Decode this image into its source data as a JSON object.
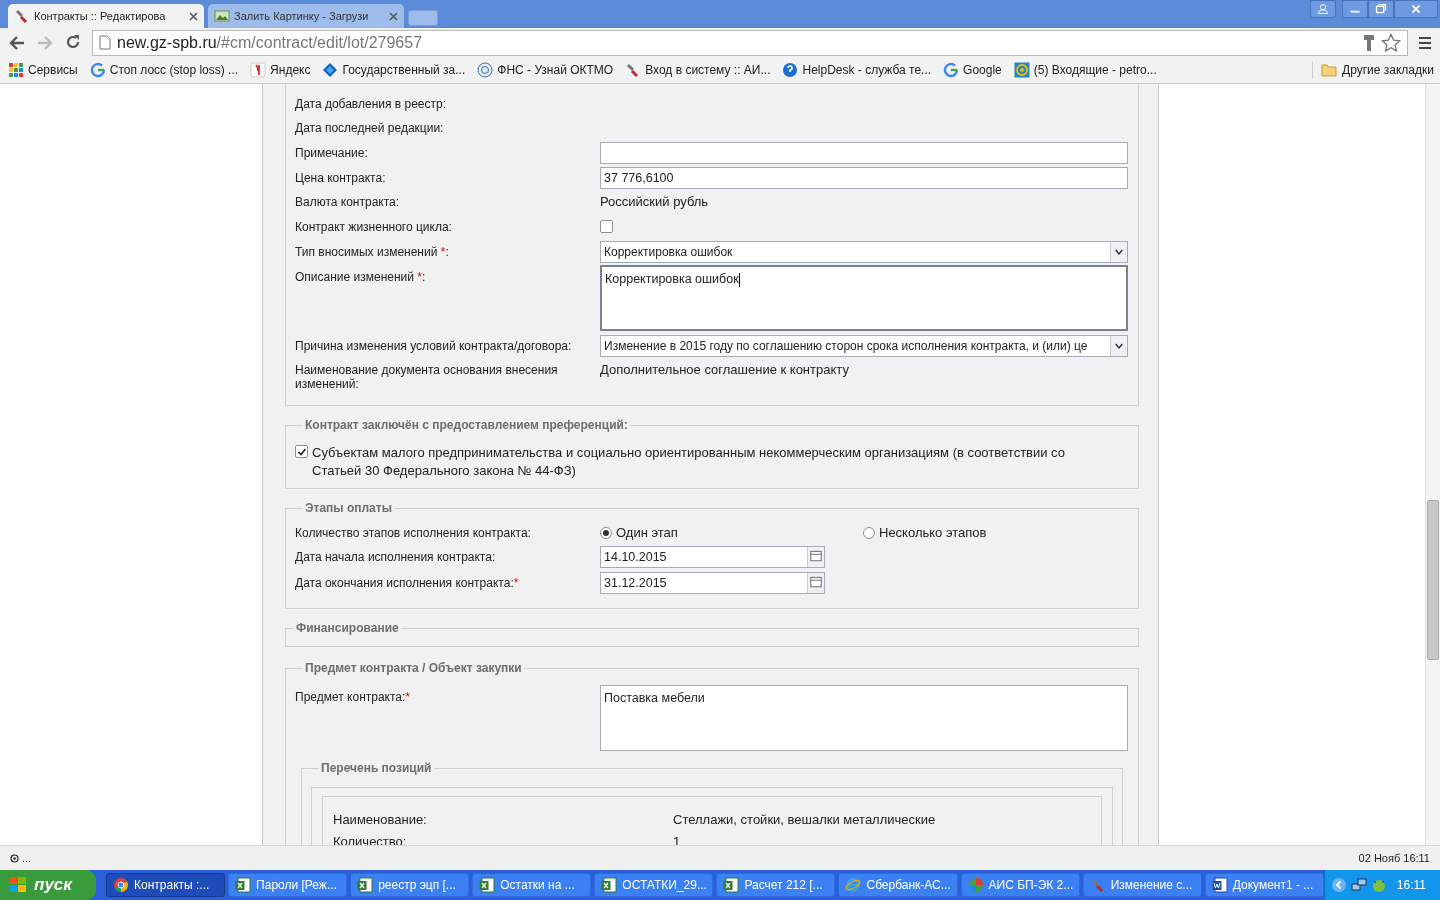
{
  "browser": {
    "tabs": [
      {
        "title": "Контракты :: Редактирова",
        "selected": true,
        "kind": "tool"
      },
      {
        "title": "Залить Картинку - Загрузи",
        "selected": false,
        "kind": "image"
      }
    ],
    "url_host": "new.gz-spb.ru",
    "url_path": "/#cm/contract/edit/lot/279657",
    "bookmarks": [
      {
        "title": "Сервисы",
        "kind": "apps"
      },
      {
        "title": "Стоп лосс (stop loss) ...",
        "kind": "google"
      },
      {
        "title": "Яндекс",
        "kind": "yandex"
      },
      {
        "title": "Государственный за...",
        "kind": "diamond"
      },
      {
        "title": "ФНС - Узнай ОКТМО",
        "kind": "seal"
      },
      {
        "title": "Вход в систему :: АИ...",
        "kind": "tool"
      },
      {
        "title": "HelpDesk - служба те...",
        "kind": "help"
      },
      {
        "title": "Google",
        "kind": "google"
      },
      {
        "title": "(5) Входящие - petro...",
        "kind": "mail"
      }
    ],
    "other_bookmarks": "Другие закладки"
  },
  "form": {
    "main_rows": [
      {
        "kind": "text",
        "label": "Дата добавления в реестр:"
      },
      {
        "kind": "text",
        "label": "Дата последней редакции:"
      },
      {
        "kind": "input",
        "label": "Примечание:"
      },
      {
        "kind": "input",
        "label": "Цена контракта:",
        "value": "37 776,6100"
      },
      {
        "kind": "text",
        "label": "Валюта контракта:",
        "value": "Российский рубль"
      },
      {
        "kind": "checkbox",
        "label": "Контракт жизненного цикла:",
        "checked": false
      },
      {
        "kind": "select",
        "label": "Тип вносимых изменений ",
        "required_mark": "*",
        "suffix": ":",
        "value": "Корректировка ошибок"
      },
      {
        "kind": "textarea",
        "label": "Описание изменений ",
        "required_mark": "*",
        "suffix": ":",
        "value": "Корректировка ошибок",
        "focused": true
      },
      {
        "kind": "select",
        "label": "Причина изменения условий контракта/договора:",
        "value": "Изменение в 2015 году по соглашению сторон срока исполнения контракта, и (или) це"
      },
      {
        "kind": "text",
        "label": "Наименование документа основания внесения изменений:",
        "value": "Дополнительное соглашение к контракту"
      }
    ],
    "preferences": {
      "legend": "Контракт заключён с предоставлением преференций:",
      "checked": true,
      "text": "Субъектам малого предпринимательства и социально ориентированным некоммерческим организациям (в соответствии со Статьей 30 Федерального закона № 44-ФЗ)"
    },
    "payment": {
      "legend": "Этапы оплаты",
      "stages_label": "Количество этапов исполнения контракта:",
      "options": [
        {
          "label": "Один этап",
          "selected": true
        },
        {
          "label": "Несколько этапов",
          "selected": false
        }
      ],
      "dates": [
        {
          "label": "Дата начала исполнения контракта:",
          "value": "14.10.2015"
        },
        {
          "label": "Дата окончания исполнения контракта:",
          "required_mark": "*",
          "value": "31.12.2015"
        }
      ]
    },
    "financing": {
      "legend": "Финансирование"
    },
    "subject": {
      "legend": "Предмет контракта / Объект закупки",
      "label": "Предмет контракта:",
      "required_mark": "*",
      "value": "Поставка мебели",
      "positions": {
        "legend": "Перечень позиций",
        "rows": [
          {
            "label": "Наименование:",
            "value": "Стеллажи, стойки, вешалки металлические"
          },
          {
            "label": "Количество:",
            "value": "1"
          }
        ]
      }
    }
  },
  "status_bar": {
    "left": "...",
    "right": "02 Нояб 16:11"
  },
  "taskbar": {
    "start": "пуск",
    "items": [
      {
        "label": "Контракты :...",
        "selected": true,
        "kind": "chrome"
      },
      {
        "label": "Пароли  [Реж...",
        "selected": false,
        "kind": "excel"
      },
      {
        "label": "реестр эцп  [...",
        "selected": false,
        "kind": "excel"
      },
      {
        "label": "Остатки  на ...",
        "selected": false,
        "kind": "excel"
      },
      {
        "label": "ОСТАТКИ_29...",
        "selected": false,
        "kind": "excel"
      },
      {
        "label": "Расчет 212  [...",
        "selected": false,
        "kind": "excel"
      },
      {
        "label": "Сбербанк-АС...",
        "selected": false,
        "kind": "ie"
      },
      {
        "label": "АИС БП-ЭК 2...",
        "selected": false,
        "kind": "globe"
      },
      {
        "label": "Изменение с...",
        "selected": false,
        "kind": "tool"
      },
      {
        "label": "Документ1 - ...",
        "selected": false,
        "kind": "word"
      }
    ],
    "clock": "16:11"
  }
}
